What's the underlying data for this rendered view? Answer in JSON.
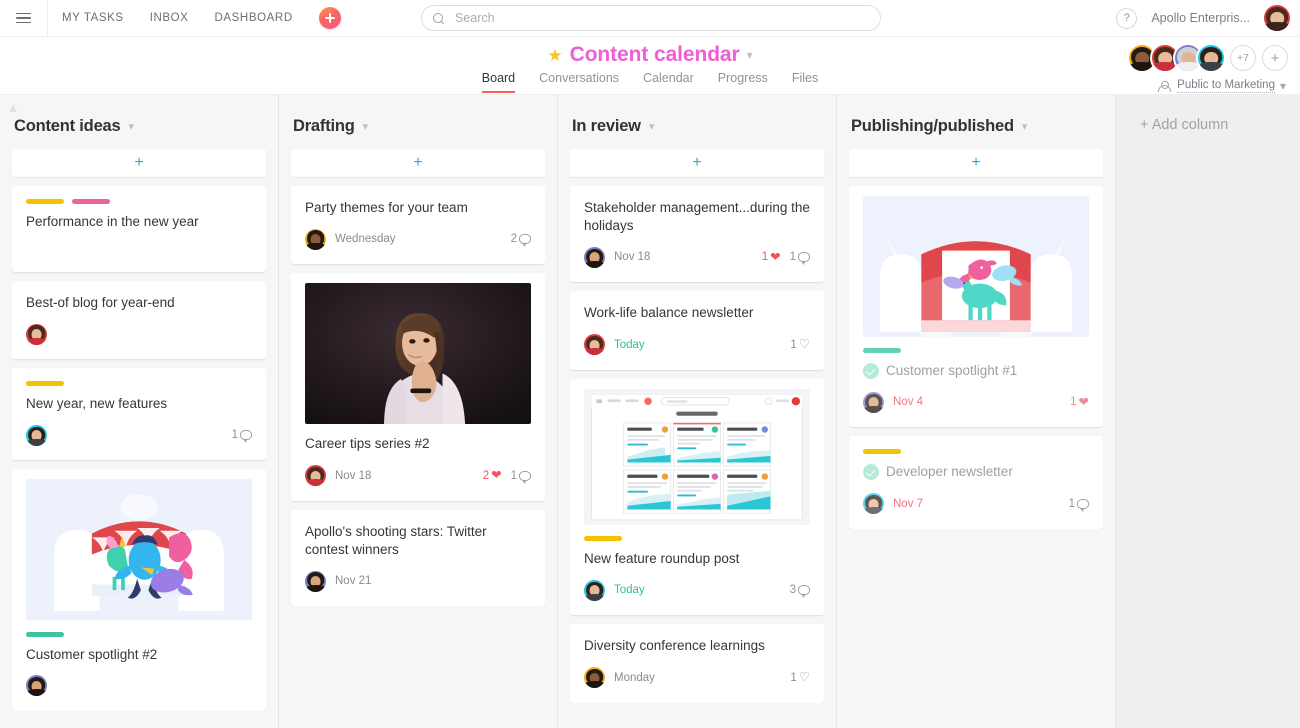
{
  "topbar": {
    "menu_icon": "hamburger-icon",
    "nav": [
      {
        "label": "MY TASKS"
      },
      {
        "label": "INBOX"
      },
      {
        "label": "DASHBOARD"
      }
    ],
    "create_button": "quick-add-icon",
    "search": {
      "placeholder": "Search",
      "value": "",
      "icon": "search-icon"
    },
    "help_label": "?",
    "org_name": "Apollo Enterpris...",
    "user_avatar": "avatar-woman-red"
  },
  "project": {
    "starred": true,
    "star_icon": "star-icon",
    "title": "Content calendar",
    "title_color": "#ef5fd4",
    "dropdown_icon": "chevron-down-icon",
    "tabs": [
      {
        "label": "Board",
        "active": true
      },
      {
        "label": "Conversations",
        "active": false
      },
      {
        "label": "Calendar",
        "active": false
      },
      {
        "label": "Progress",
        "active": false
      },
      {
        "label": "Files",
        "active": false
      }
    ],
    "members_overflow": "+7",
    "add_member_label": "+",
    "privacy_label": "Public to Marketing",
    "privacy_icon": "people-icon"
  },
  "board": {
    "collapse_icon": "chevron-up-icon",
    "add_column_label": "+ Add column",
    "add_card_icon": "plus-icon",
    "columns": [
      {
        "title": "Content ideas",
        "cards": [
          {
            "title": "Performance in the new year",
            "tags": [
              "#f3c300",
              "#f0629e"
            ],
            "assignee": null,
            "due": null,
            "likes": null,
            "comments": null
          },
          {
            "title": "Best-of blog for year-end",
            "tags": [],
            "assignee": "avatar-woman-red",
            "due": null,
            "likes": null,
            "comments": null
          },
          {
            "title": "New year, new features",
            "tags": [
              "#f3c300"
            ],
            "assignee": "avatar-man-cyan",
            "due": null,
            "likes": null,
            "comments": "1"
          },
          {
            "title": "Customer spotlight #2",
            "tags": [
              "#3ec4a0"
            ],
            "image": "illustration-circus-unicorns",
            "assignee": "avatar-man-purple",
            "due": null,
            "likes": null,
            "comments": null
          }
        ]
      },
      {
        "title": "Drafting",
        "cards": [
          {
            "title": "Party themes for your team",
            "tags": [],
            "assignee": "avatar-woman-yellow",
            "due": "Wednesday",
            "due_state": "normal",
            "likes": null,
            "comments": "2"
          },
          {
            "title": "Career tips series #2",
            "tags": [],
            "image": "photo-woman-thinking",
            "assignee": "avatar-woman-red",
            "due": "Nov 18",
            "due_state": "normal",
            "likes": "2",
            "liked": true,
            "comments": "1"
          },
          {
            "title": "Apollo's shooting stars: Twitter contest winners",
            "tags": [],
            "assignee": "avatar-man-purple",
            "due": "Nov 21",
            "due_state": "normal",
            "likes": null,
            "comments": null
          }
        ]
      },
      {
        "title": "In review",
        "cards": [
          {
            "title": "Stakeholder management...during the holidays",
            "tags": [],
            "assignee": "avatar-man-purple",
            "due": "Nov 18",
            "due_state": "normal",
            "likes": "1",
            "liked": true,
            "comments": "1"
          },
          {
            "title": "Work-life balance newsletter",
            "tags": [],
            "assignee": "avatar-woman-red",
            "due": "Today",
            "due_state": "today",
            "likes": "1",
            "liked": false,
            "comments": null
          },
          {
            "title": "New feature roundup post",
            "tags": [
              "#f3c300"
            ],
            "image": "screenshot-my-dashboard",
            "assignee": "avatar-man-cyan",
            "due": "Today",
            "due_state": "today",
            "likes": null,
            "comments": "3"
          },
          {
            "title": "Diversity conference learnings",
            "tags": [],
            "assignee": "avatar-woman-yellow",
            "due": "Monday",
            "due_state": "normal",
            "likes": "1",
            "liked": false,
            "comments": null
          }
        ]
      },
      {
        "title": "Publishing/published",
        "cards": [
          {
            "title": "Customer spotlight #1",
            "tags": [
              "#5fd3b4"
            ],
            "image": "illustration-stage-unicorn",
            "completed": true,
            "assignee": "avatar-man-purple",
            "due": "Nov 4",
            "due_state": "overdue",
            "likes": "1",
            "liked": true,
            "comments": null
          },
          {
            "title": "Developer newsletter",
            "tags": [
              "#f3c300"
            ],
            "completed": true,
            "assignee": "avatar-man-cyan",
            "due": "Nov 7",
            "due_state": "overdue",
            "likes": null,
            "comments": "1"
          }
        ]
      }
    ]
  },
  "screenshot_card": {
    "app_title": "My Dashboard",
    "widgets": [
      {
        "name": "Bug Tracking"
      },
      {
        "name": "Website Launch"
      },
      {
        "name": "HR Weekly Meeting"
      },
      {
        "name": "Editorial Calendar"
      },
      {
        "name": "Company Milestones"
      },
      {
        "name": "Email Lifecycle Mar..."
      }
    ]
  }
}
